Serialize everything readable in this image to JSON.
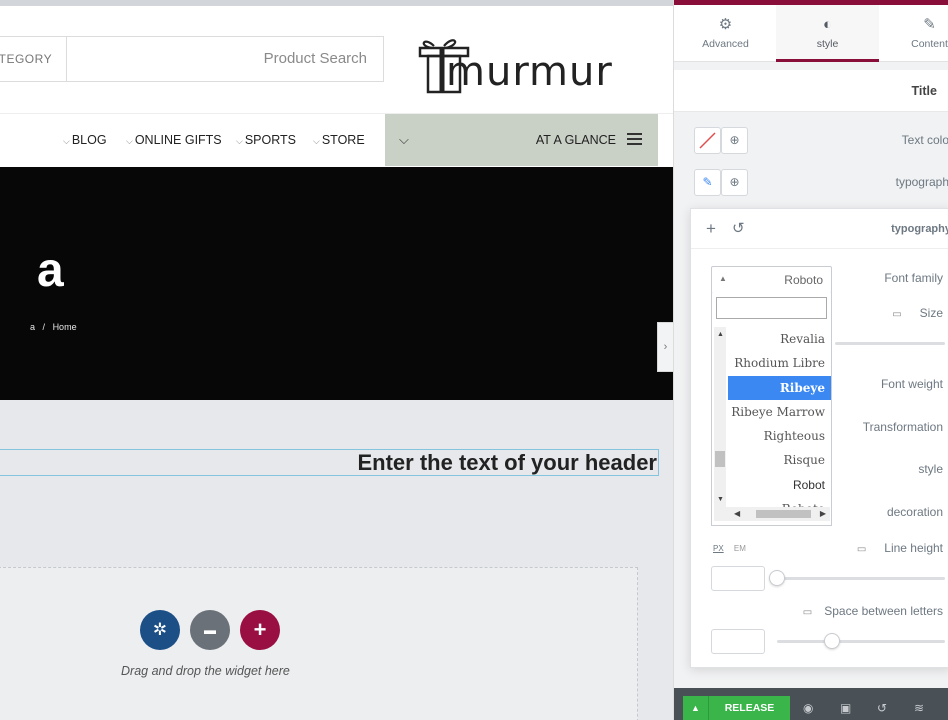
{
  "preview": {
    "search": {
      "category_label": "ATEGORY",
      "placeholder": "Product Search"
    },
    "logo": {
      "text": "murmur"
    },
    "nav": {
      "items": [
        {
          "label": "BLOG"
        },
        {
          "label": "ONLINE GIFTS"
        },
        {
          "label": "SPORTS"
        },
        {
          "label": "STORE"
        }
      ],
      "glance_label": "AT A GLANCE"
    },
    "hero": {
      "title": "a",
      "breadcrumb": [
        "a",
        "/",
        "Home"
      ]
    },
    "heading": {
      "text": "Enter the text of your header"
    },
    "dropzone": {
      "text": "Drag and drop the widget here",
      "buttons": [
        {
          "icon": "joomla-icon",
          "glyph": "✲",
          "color": "#1c4f86"
        },
        {
          "icon": "folder-icon",
          "glyph": "▬",
          "color": "#6b7178"
        },
        {
          "icon": "plus-icon",
          "glyph": "+",
          "color": "#9a0f42"
        }
      ]
    }
  },
  "panel": {
    "tabs": [
      {
        "label": "Advanced",
        "icon": "gear-icon",
        "glyph": "⚙"
      },
      {
        "label": "style",
        "icon": "contrast-icon",
        "glyph": "◐",
        "active": true
      },
      {
        "label": "Content",
        "icon": "pencil-icon",
        "glyph": "✎"
      }
    ],
    "section_title": "Title",
    "text_color_label": "Text colo",
    "typography_label": "typograph",
    "popover": {
      "title": "typography",
      "font_family_label": "Font family",
      "size_label": "Size",
      "font_weight_label": "Font weight",
      "transformation_label": "Transformation",
      "style_label": "style",
      "decoration_label": "decoration",
      "line_height_label": "Line height",
      "letter_spacing_label": "Space between letters",
      "unit_px": "PX",
      "unit_em": "EM",
      "font_family_value": "Roboto",
      "font_options": [
        "Revalia",
        "Rhodium Libre",
        "Ribeye",
        "Ribeye Marrow",
        "Righteous",
        "Risque",
        "Robot",
        "Roboto"
      ],
      "selected_font": "Ribeye"
    },
    "footer": {
      "release_label": "RELEASE"
    }
  },
  "colors": {
    "accent": "#8a0e3a",
    "release_green": "#39b54a",
    "selection_blue": "#3b88f3",
    "nav_green": "#c9d0c5"
  }
}
